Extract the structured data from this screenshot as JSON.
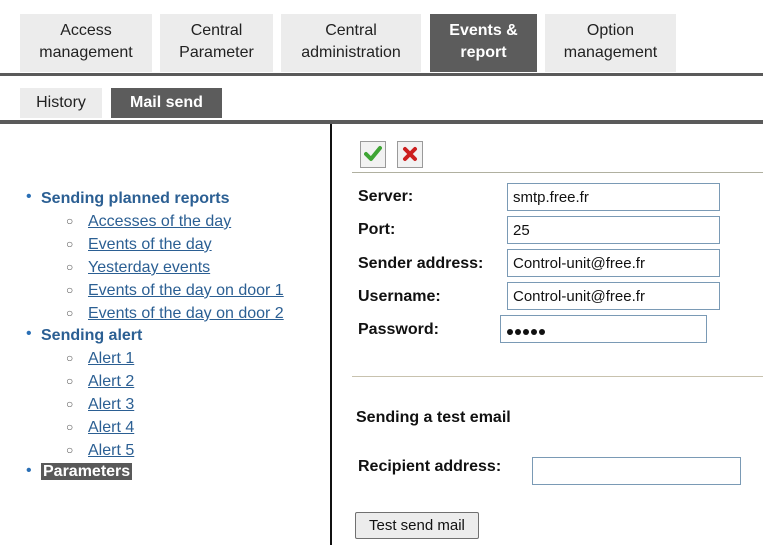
{
  "top_nav": {
    "tabs": [
      {
        "line1": "Access",
        "line2": "management",
        "active": false
      },
      {
        "line1": "Central",
        "line2": "Parameter",
        "active": false
      },
      {
        "line1": "Central",
        "line2": "administration",
        "active": false
      },
      {
        "line1": "Events &",
        "line2": "report",
        "active": true
      },
      {
        "line1": "Option",
        "line2": "management",
        "active": false
      }
    ]
  },
  "sub_nav": {
    "tabs": [
      {
        "label": "History",
        "active": false
      },
      {
        "label": "Mail send",
        "active": true
      }
    ]
  },
  "tree": {
    "groups": [
      {
        "title": "Sending planned reports",
        "items": [
          "Accesses of the day",
          "Events of the day",
          "Yesterday events",
          "Events of the day on door 1",
          "Events of the day on door 2"
        ]
      },
      {
        "title": "Sending alert",
        "items": [
          "Alert 1",
          "Alert 2",
          "Alert 3",
          "Alert 4",
          "Alert 5"
        ]
      }
    ],
    "selected": "Parameters"
  },
  "form": {
    "server_label": "Server:",
    "server_value": "smtp.free.fr",
    "port_label": "Port:",
    "port_value": "25",
    "sender_label": "Sender address:",
    "sender_value": "Control-unit@free.fr",
    "username_label": "Username:",
    "username_value": "Control-unit@free.fr",
    "password_label": "Password:"
  },
  "test": {
    "section_title": "Sending a test email",
    "recipient_label": "Recipient address:",
    "recipient_value": "",
    "button_label": "Test send mail"
  },
  "icons": {
    "confirm": "check-icon",
    "cancel": "cross-icon"
  },
  "colors": {
    "active_tab": "#5c5c5c",
    "link": "#2b5f93",
    "confirm": "#3fa535",
    "cancel": "#cc1f1f"
  }
}
